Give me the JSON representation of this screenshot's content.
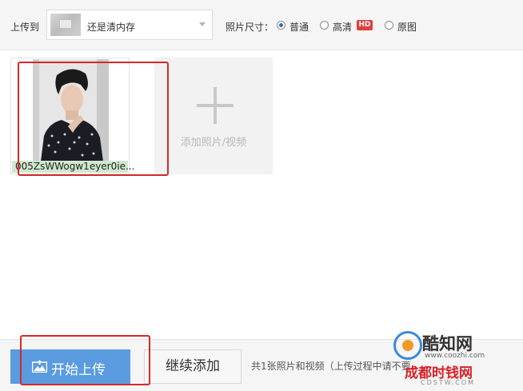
{
  "toolbar": {
    "upload_to_label": "上传到",
    "album_selected": "还是清内存",
    "photo_size_label": "照片尺寸：",
    "size_options": [
      {
        "label": "普通",
        "selected": true
      },
      {
        "label": "高清",
        "selected": false,
        "badge": "HD"
      },
      {
        "label": "原图",
        "selected": false
      }
    ]
  },
  "upload_list": {
    "items": [
      {
        "filename": "005ZsWWogw1eyer0ie..."
      }
    ],
    "add_tile_label": "添加照片/视频"
  },
  "footer": {
    "start_upload_label": "开始上传",
    "continue_add_label": "继续添加",
    "summary_text": "共1张照片和视频（上传过程中请不要关闭页面）"
  },
  "watermark": {
    "brand": "酷知网",
    "url": "www.coozhi.com",
    "site": "成都时钱网",
    "site_url": "CDSTW.COM"
  },
  "colors": {
    "accent_blue": "#5b9be0",
    "hd_badge": "#e0403a",
    "annotation_red": "#d42a2a",
    "filename_bar": "#cfe9cf"
  }
}
